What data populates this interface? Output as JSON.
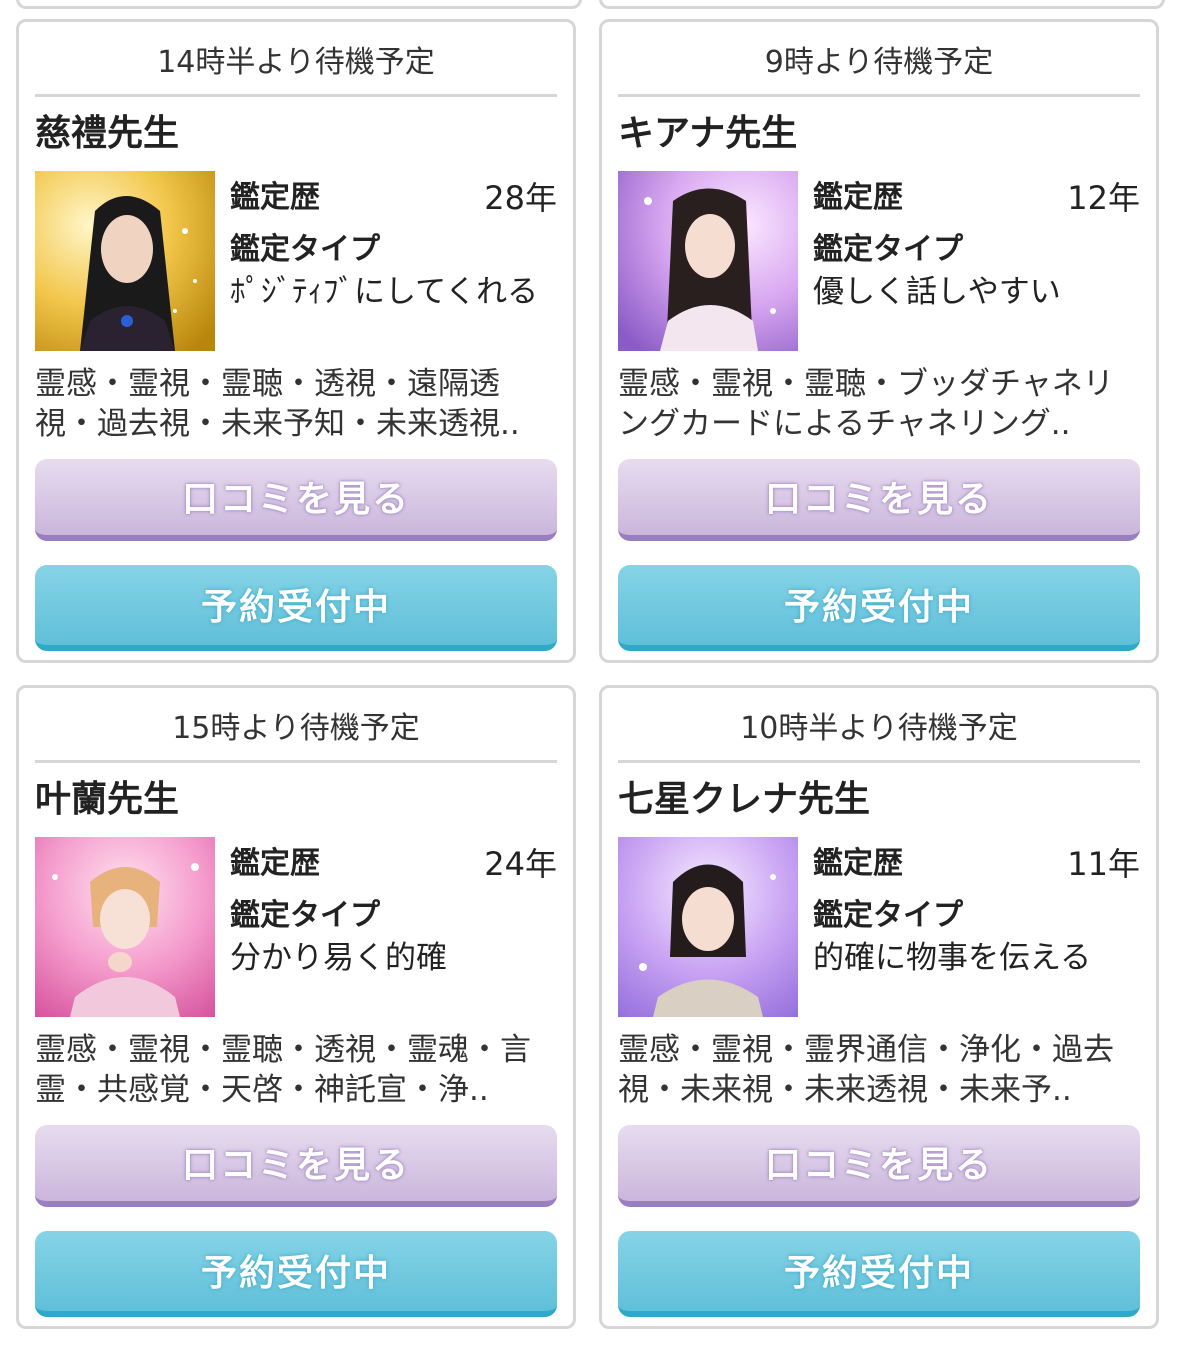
{
  "colors": {
    "card_border": "#d6d6d6",
    "review_button": "#cbb6dc",
    "reserve_button": "#5fc0d9"
  },
  "labels": {
    "experience": "鑑定歴",
    "type": "鑑定タイプ"
  },
  "cards": [
    {
      "status": "14時半より待機予定",
      "name": "慈禮先生",
      "experience": "28年",
      "type": "ﾎﾟｼﾞﾃｨﾌﾞにしてくれる",
      "abilities": "霊感・霊視・霊聴・透視・遠隔透視・過去視・未来予知・未来透視..",
      "review_label": "口コミを見る",
      "reserve_label": "予約受付中",
      "photo_icon": "fortune-teller-portrait"
    },
    {
      "status": "9時より待機予定",
      "name": "キアナ先生",
      "experience": "12年",
      "type": "優しく話しやすい",
      "abilities": "霊感・霊視・霊聴・ブッダチャネリングカードによるチャネリング..",
      "review_label": "口コミを見る",
      "reserve_label": "予約受付中",
      "photo_icon": "fortune-teller-portrait"
    },
    {
      "status": "15時より待機予定",
      "name": "叶蘭先生",
      "experience": "24年",
      "type": "分かり易く的確",
      "abilities": "霊感・霊視・霊聴・透視・霊魂・言霊・共感覚・天啓・神託宣・浄..",
      "review_label": "口コミを見る",
      "reserve_label": "予約受付中",
      "photo_icon": "fortune-teller-portrait"
    },
    {
      "status": "10時半より待機予定",
      "name": "七星クレナ先生",
      "experience": "11年",
      "type": "的確に物事を伝える",
      "abilities": "霊感・霊視・霊界通信・浄化・過去視・未来視・未来透視・未来予..",
      "review_label": "口コミを見る",
      "reserve_label": "予約受付中",
      "photo_icon": "fortune-teller-portrait"
    }
  ]
}
